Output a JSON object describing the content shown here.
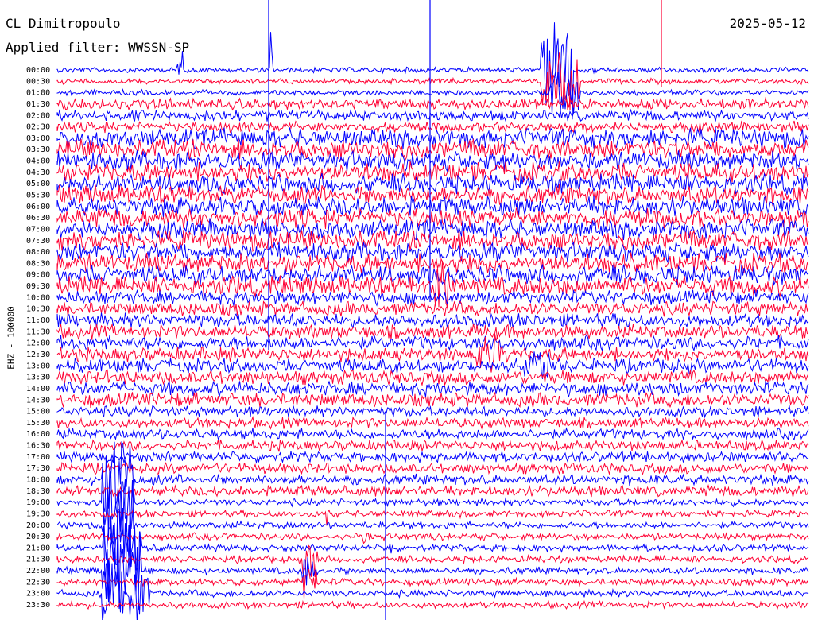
{
  "header": {
    "station": "CL Dimitropoulo",
    "filter": "Applied filter: WWSSN-SP",
    "date": "2025-05-12"
  },
  "chart_data": {
    "type": "line",
    "title": "CL Dimitropoulo",
    "channel_label": "EHZ - 100000",
    "row_labels": [
      "00:00",
      "00:30",
      "01:00",
      "01:30",
      "02:00",
      "02:30",
      "03:00",
      "03:30",
      "04:00",
      "04:30",
      "05:00",
      "05:30",
      "06:00",
      "06:30",
      "07:00",
      "07:30",
      "08:00",
      "08:30",
      "09:00",
      "09:30",
      "10:00",
      "10:30",
      "11:00",
      "11:30",
      "12:00",
      "12:30",
      "13:00",
      "13:30",
      "14:00",
      "14:30",
      "15:00",
      "15:30",
      "16:00",
      "16:30",
      "17:00",
      "17:30",
      "18:00",
      "18:30",
      "19:00",
      "19:30",
      "20:00",
      "20:30",
      "21:00",
      "21:30",
      "22:00",
      "22:30",
      "23:00",
      "23:30"
    ],
    "colors": [
      "#0000ff",
      "#ff0033"
    ],
    "grid": false
  }
}
